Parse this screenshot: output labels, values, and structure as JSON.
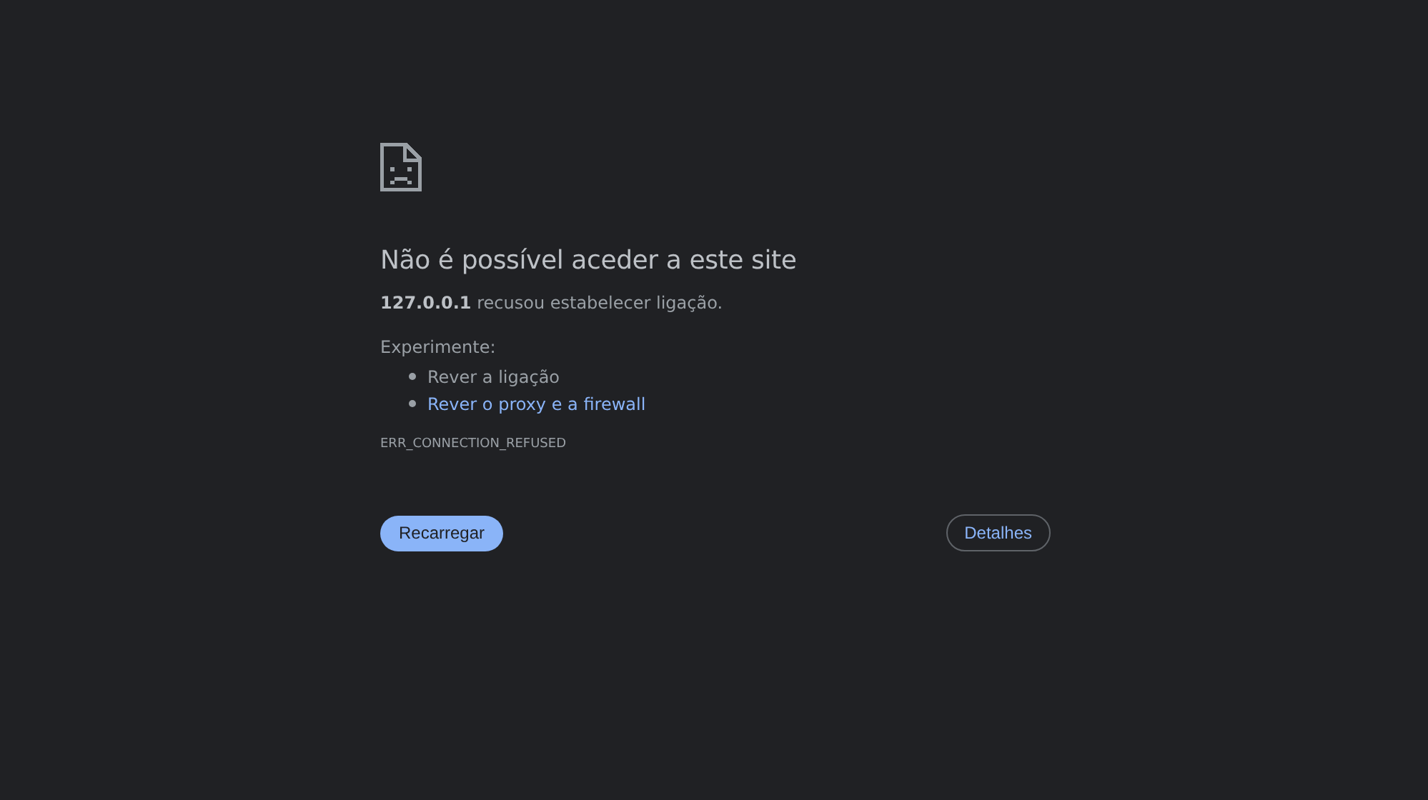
{
  "title": "Não é possível aceder a este site",
  "description": "**127.0.0.1** recusou estabelecer ligação.",
  "suggestions_heading": "Experimente:",
  "suggestions": [
    {
      "kind": "text",
      "text": "Rever a ligação"
    },
    {
      "kind": "link",
      "text": "Rever o proxy e a firewall"
    }
  ],
  "error_code": "ERR_CONNECTION_REFUSED",
  "buttons": {
    "reload": "Recarregar",
    "details": "Detalhes"
  }
}
